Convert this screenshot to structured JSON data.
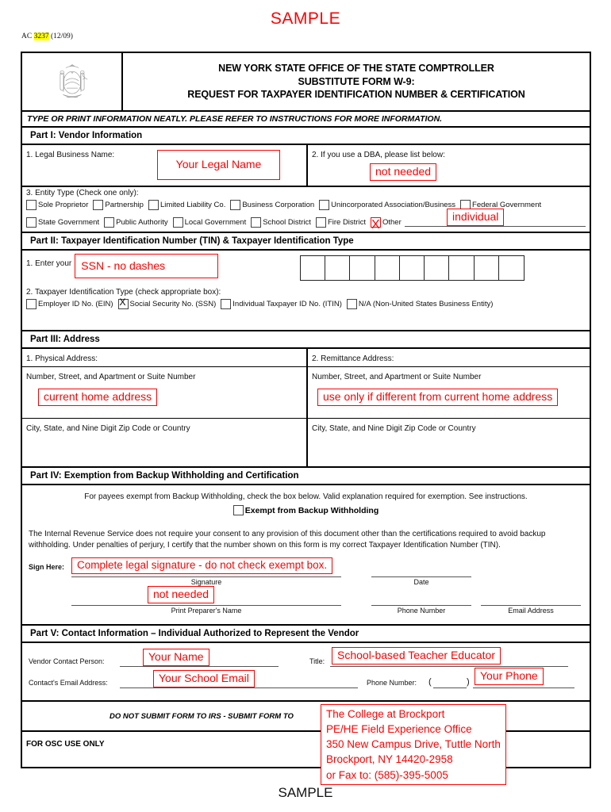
{
  "watermark": {
    "top": "SAMPLE",
    "bottom": "SAMPLE"
  },
  "form_meta": {
    "prefix": "AC",
    "number": "3237",
    "revision": "(12/09)"
  },
  "header": {
    "line1": "NEW YORK STATE OFFICE OF THE STATE COMPTROLLER",
    "line2": "SUBSTITUTE FORM W-9:",
    "line3": "REQUEST FOR TAXPAYER IDENTIFICATION NUMBER & CERTIFICATION",
    "seal_icon": "new-york-state-seal"
  },
  "notice": "TYPE OR PRINT INFORMATION NEATLY.  PLEASE REFER TO INSTRUCTIONS FOR MORE INFORMATION.",
  "part1": {
    "heading": "Part I: Vendor Information",
    "legal_name_label": "1. Legal Business Name:",
    "legal_name_value": "Your Legal Name",
    "dba_label": "2. If you use a DBA, please list below:",
    "dba_value": "not needed",
    "entity_label": "3. Entity Type (Check one only):",
    "entity_row1": [
      {
        "label": "Sole Proprietor",
        "checked": false
      },
      {
        "label": "Partnership",
        "checked": false
      },
      {
        "label": "Limited Liability Co.",
        "checked": false
      },
      {
        "label": "Business Corporation",
        "checked": false
      },
      {
        "label": "Unincorporated Association/Business",
        "checked": false
      },
      {
        "label": "Federal Government",
        "checked": false
      }
    ],
    "entity_row2": [
      {
        "label": "State Government",
        "checked": false
      },
      {
        "label": "Public Authority",
        "checked": false
      },
      {
        "label": "Local Government",
        "checked": false
      },
      {
        "label": "School District",
        "checked": false
      },
      {
        "label": "Fire District",
        "checked": false
      },
      {
        "label": "Other",
        "checked": true
      }
    ],
    "entity_other_value": "individual"
  },
  "part2": {
    "heading": "Part II: Taxpayer Identification Number (TIN) & Taxpayer Identification Type",
    "enter_label": "1. Enter your",
    "tin_value": "SSN - no dashes",
    "tin_boxes": 9,
    "type_label": "2. Taxpayer Identification Type (check appropriate box):",
    "types": [
      {
        "label": "Employer ID No. (EIN)",
        "checked": false
      },
      {
        "label": "Social Security No. (SSN)",
        "checked": true
      },
      {
        "label": "Individual Taxpayer ID No. (ITIN)",
        "checked": false
      },
      {
        "label": "N/A (Non-United States Business Entity)",
        "checked": false
      }
    ]
  },
  "part3": {
    "heading": "Part III: Address",
    "physical_label": "1. Physical Address:",
    "remittance_label": "2. Remittance Address:",
    "street_label": "Number, Street, and Apartment or Suite Number",
    "physical_street_value": "current home address",
    "remittance_street_value": "use only if different from current home address",
    "city_label": "City, State, and Nine Digit Zip Code or Country"
  },
  "part4": {
    "heading": "Part IV: Exemption from Backup Withholding and Certification",
    "exempt_instruction": "For payees exempt from Backup Withholding, check the box below.  Valid explanation required for exemption.  See instructions.",
    "exempt_checkbox_label": "Exempt from Backup Withholding",
    "exempt_checked": false,
    "certification": "The Internal Revenue Service does not require your consent to any provision of this document other than the certifications required to avoid backup withholding.  Under penalties of perjury, I certify that the number shown on this form is my correct Taxpayer Identification Number (TIN).",
    "sign_here_label": "Sign Here:",
    "signature_value": "Complete legal signature - do not check exempt box.",
    "signature_caption": "Signature",
    "date_caption": "Date",
    "preparer_value": "not needed",
    "preparer_caption": "Print Preparer's Name",
    "phone_caption": "Phone Number",
    "email_caption": "Email Address"
  },
  "part5": {
    "heading": "Part V: Contact Information – Individual Authorized to Represent the Vendor",
    "contact_person_label": "Vendor Contact Person:",
    "contact_person_value": "Your Name",
    "title_label": "Title:",
    "title_value": "School-based Teacher Educator",
    "email_label": "Contact's Email Address:",
    "email_value": "Your School Email",
    "phone_label": "Phone Number:",
    "phone_paren_open": "(",
    "phone_paren_close": ")",
    "phone_value": "Your Phone"
  },
  "footer": {
    "submit_note": "DO NOT SUBMIT FORM TO IRS - SUBMIT FORM TO",
    "osc_label": "FOR OSC USE ONLY",
    "submit_to": "The College at Brockport\nPE/HE Field Experience Office\n350 New Campus Drive, Tuttle North\nBrockport, NY 14420-2958\nor Fax to: (585)-395-5005"
  },
  "colors": {
    "annotation_red": "#ff0000",
    "highlight_yellow": "#ffff00",
    "rule_black": "#000000"
  }
}
